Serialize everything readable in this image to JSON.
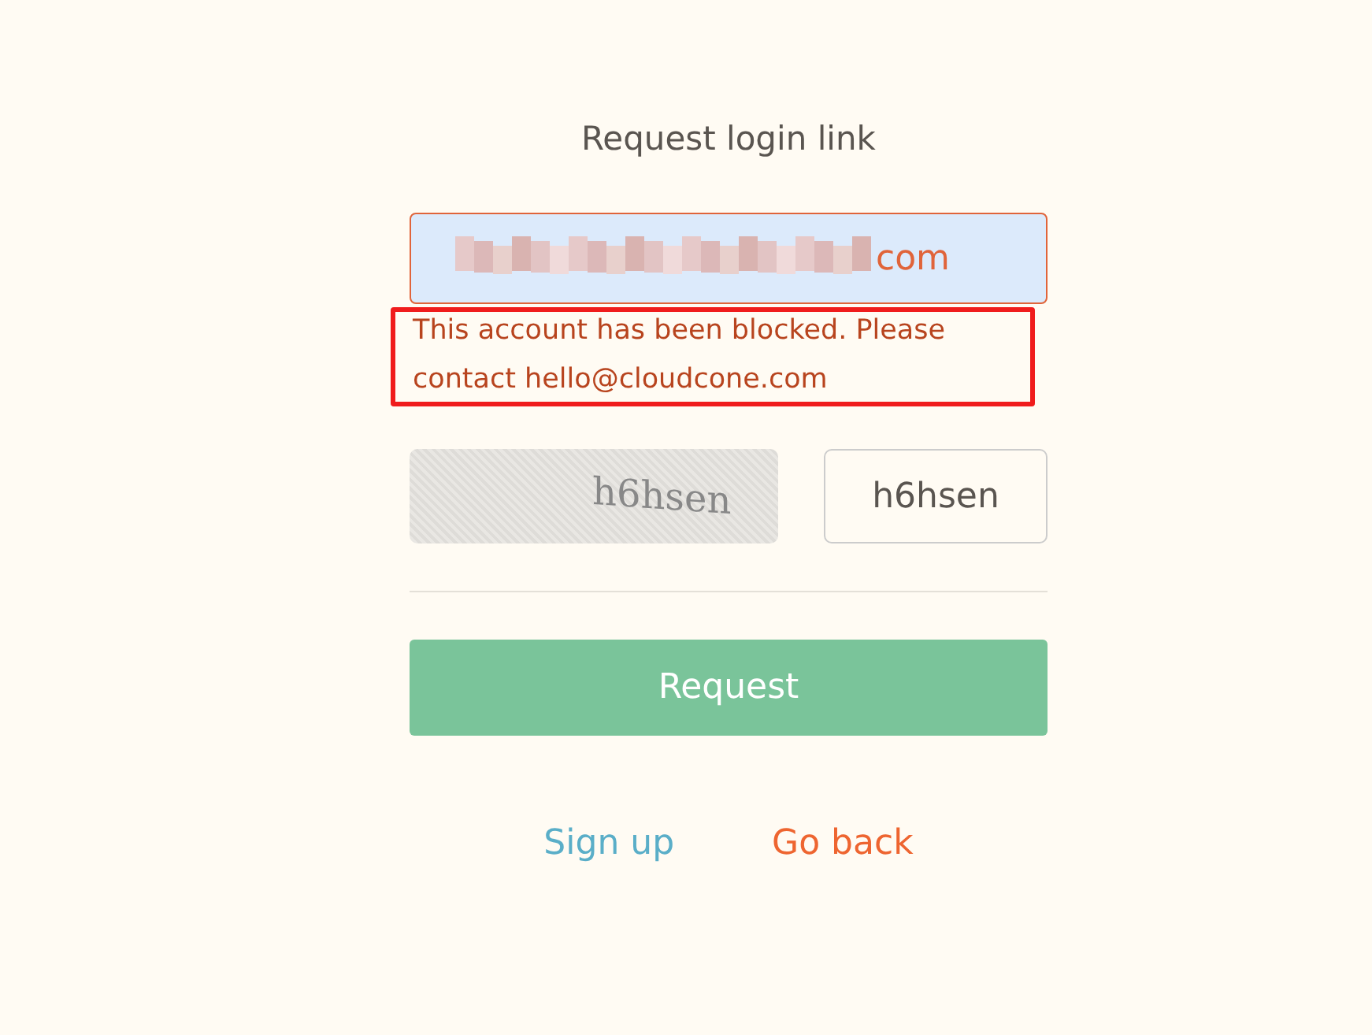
{
  "title": "Request login link",
  "email": {
    "value": "com",
    "redacted": true,
    "invalid": true
  },
  "error": {
    "text": "This account has been blocked. Please contact hello@cloudcone.com",
    "highlighted": true
  },
  "captcha": {
    "image_text": "h6hsen",
    "value": "h6hsen"
  },
  "submit": {
    "label": "Request"
  },
  "links": [
    {
      "label": "Sign up",
      "kind": "primary"
    },
    {
      "label": "Go back",
      "kind": "secondary"
    }
  ]
}
